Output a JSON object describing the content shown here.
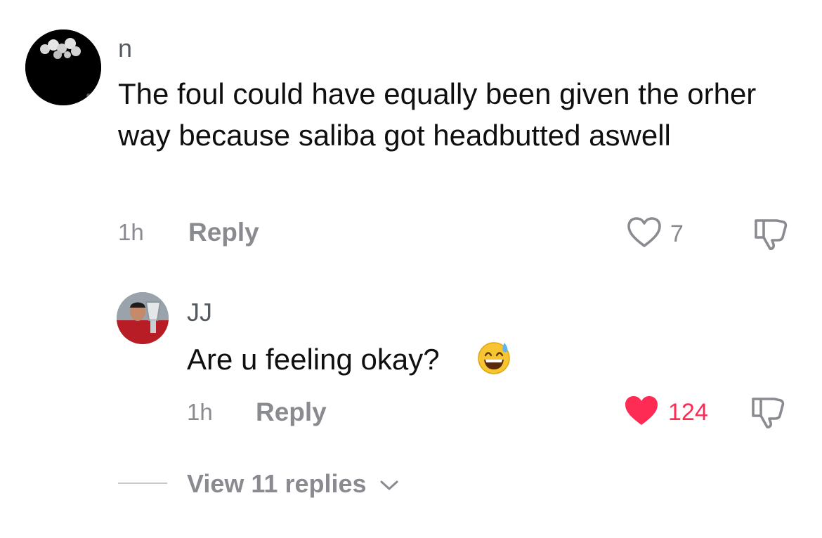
{
  "comment": {
    "username": "n",
    "text": "The foul could have equally been given the orher way because saliba got headbutted aswell",
    "time": "1h",
    "reply_label": "Reply",
    "like_count": "7",
    "liked": false
  },
  "reply": {
    "username": "JJ",
    "text": "Are u feeling okay?",
    "time": "1h",
    "reply_label": "Reply",
    "like_count": "124",
    "liked": true
  },
  "view_replies_label": "View 11 replies",
  "icons": {
    "heart_outline": "heart-outline-icon",
    "heart_filled": "heart-filled-icon",
    "dislike": "thumbs-down-icon",
    "emoji": "grinning-sweat-emoji",
    "chevron": "chevron-down-icon"
  },
  "colors": {
    "like_active": "#fe2c55",
    "secondary_text": "#8a8b91",
    "primary_text": "#0f0f0f"
  }
}
